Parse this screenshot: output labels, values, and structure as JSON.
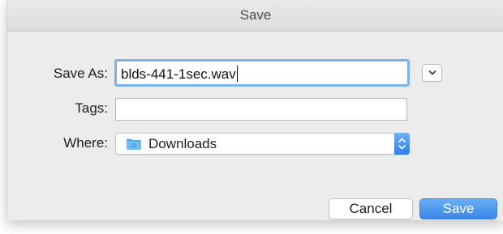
{
  "dialog": {
    "title": "Save"
  },
  "form": {
    "save_as_label": "Save As:",
    "save_as_value": "blds-441-1sec.wav",
    "tags_label": "Tags:",
    "tags_value": "",
    "where_label": "Where:",
    "where_value": "Downloads"
  },
  "buttons": {
    "cancel_label": "Cancel",
    "save_label": "Save"
  },
  "icons": {
    "expand": "chevron-down-icon",
    "folder": "folder-icon",
    "stepper": "up-down-chevron-icon"
  },
  "colors": {
    "accent": "#3a86ea",
    "focus_ring": "#7eb1ec",
    "folder": "#54a9ec"
  }
}
